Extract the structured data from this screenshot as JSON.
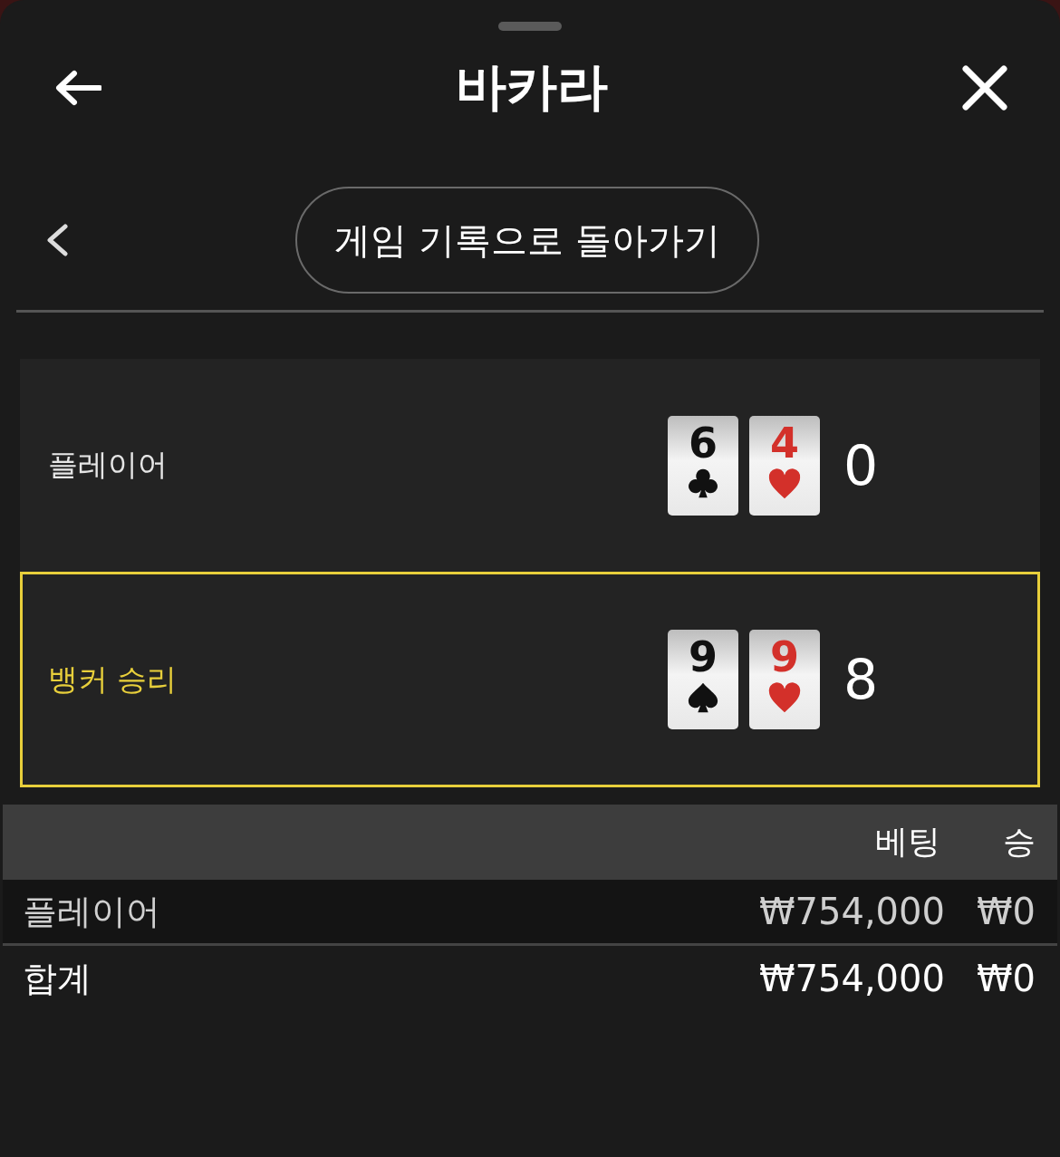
{
  "header": {
    "title": "바카라"
  },
  "nav": {
    "back_label": "게임 기록으로 돌아가기"
  },
  "hands": [
    {
      "label": "플레이어",
      "winner": false,
      "score": "0",
      "cards": [
        {
          "rank": "6",
          "kind": "clubs"
        },
        {
          "rank": "4",
          "kind": "hearts"
        }
      ]
    },
    {
      "label": "뱅커 승리",
      "winner": true,
      "score": "8",
      "cards": [
        {
          "rank": "9",
          "kind": "spades"
        },
        {
          "rank": "9",
          "kind": "hearts"
        }
      ]
    }
  ],
  "table": {
    "columns": [
      "베팅",
      "승"
    ],
    "rows": [
      {
        "kind": "line",
        "label": "플레이어",
        "bet": "₩754,000",
        "win": "₩0"
      },
      {
        "kind": "total",
        "label": "합계",
        "bet": "₩754,000",
        "win": "₩0"
      }
    ]
  }
}
